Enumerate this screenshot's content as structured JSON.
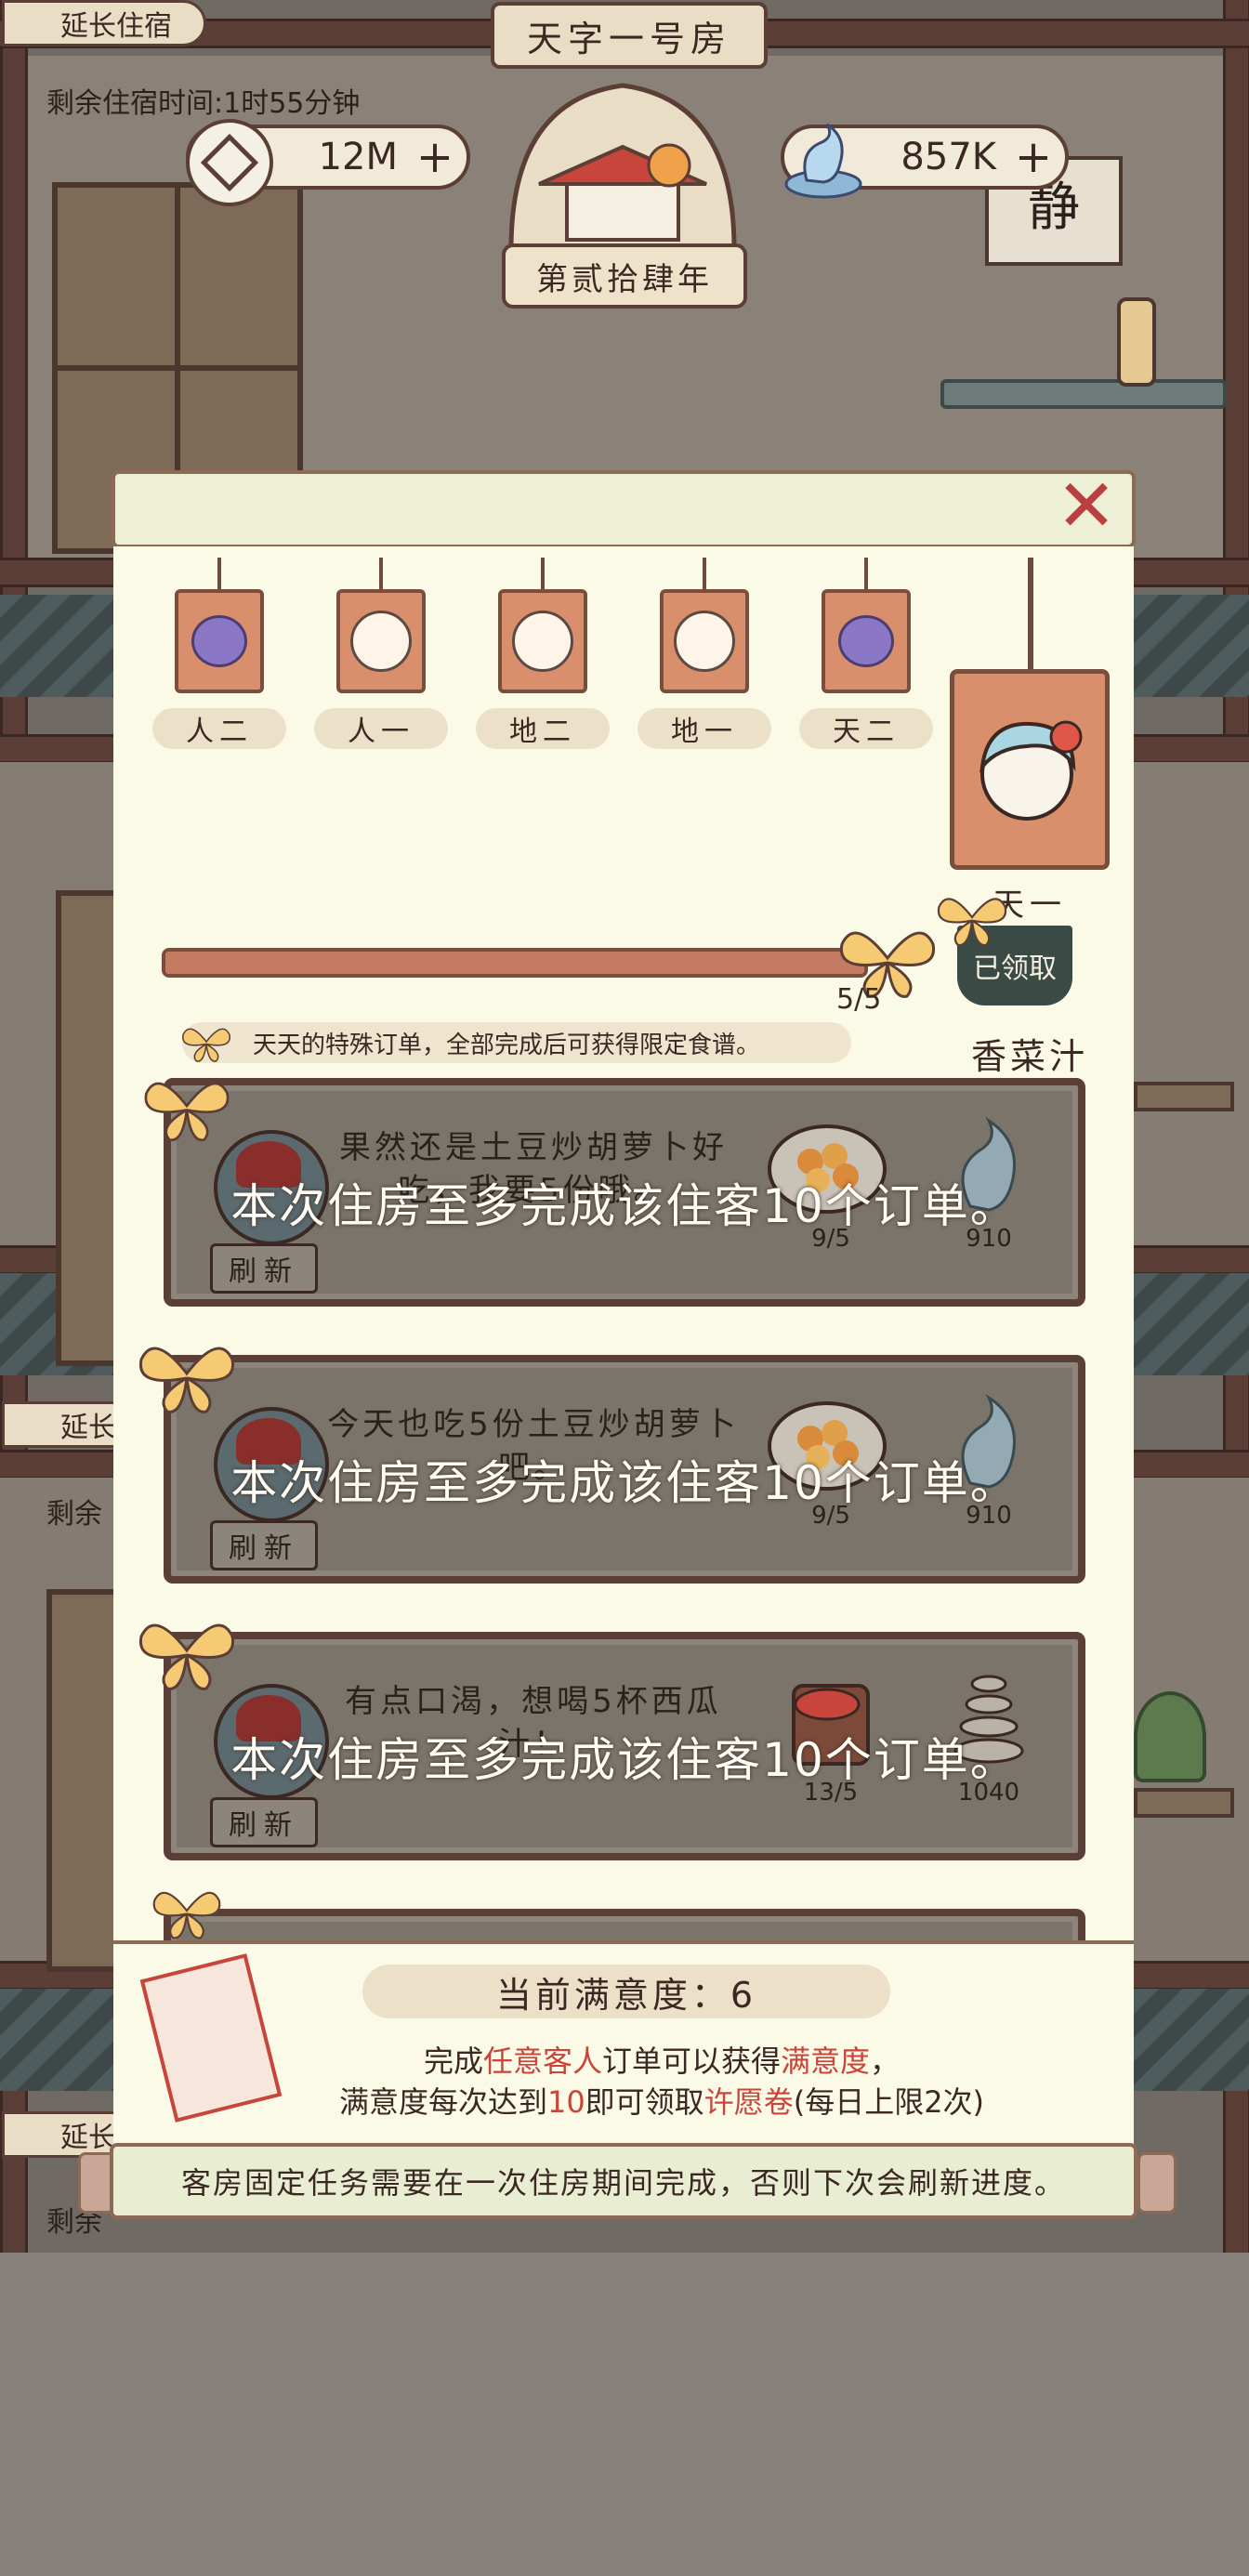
{
  "room": {
    "title": "天字一号房",
    "extend_label": "延长住宿",
    "remaining_time": "剩余住宿时间:1时55分钟",
    "year_label": "第贰拾肆年"
  },
  "resources": {
    "coins": "12M",
    "spirit": "857K"
  },
  "background_texts": {
    "extend_label_2": "延长",
    "extend_label_3": "延长",
    "remain_2": "剩余",
    "remain_3": "剩余"
  },
  "guests": [
    {
      "label": "人二",
      "icon": "fruit-icon"
    },
    {
      "label": "人一",
      "icon": "guest-face-icon"
    },
    {
      "label": "地二",
      "icon": "guest-face-icon"
    },
    {
      "label": "地一",
      "icon": "guest-face-icon"
    },
    {
      "label": "天二",
      "icon": "fruit-icon"
    }
  ],
  "selected_guest": {
    "label": "天一",
    "progress_text": "5/5",
    "progress_fraction": 1.0,
    "claimed_label": "已领取",
    "reward_name": "香菜汁"
  },
  "special_hint": "天天的特殊订单，全部完成后可获得限定食谱。",
  "orders": [
    {
      "message": "果然还是土豆炒胡萝卜好吃，我要5份哦。",
      "item_count": "9/5",
      "reward_count": "910",
      "refresh": "刷新",
      "overlay": "本次住房至多完成该住客10个订单。"
    },
    {
      "message": "今天也吃5份土豆炒胡萝卜吧。",
      "item_count": "9/5",
      "reward_count": "910",
      "refresh": "刷新",
      "overlay": "本次住房至多完成该住客10个订单。"
    },
    {
      "message": "有点口渴，想喝5杯西瓜汁！",
      "item_count": "13/5",
      "reward_count": "1040",
      "refresh": "刷新",
      "overlay": "本次住房至多完成该住客10个订单。"
    }
  ],
  "satisfaction": {
    "title": "当前满意度：6",
    "line1_a": "完成",
    "line1_hl1": "任意客人",
    "line1_b": "订单可以获得",
    "line1_hl2": "满意度",
    "line1_c": "，",
    "line2_a": "满意度每次达到",
    "line2_hl1": "10",
    "line2_b": "即可领取",
    "line2_hl2": "许愿卷",
    "line2_c": "(每日上限2次)"
  },
  "footer_note": "客房固定任务需要在一次住房期间完成，否则下次会刷新进度。",
  "colors": {
    "panel": "#fbfae6",
    "frame": "#5b3f36",
    "highlight": "#c8453b",
    "tag": "#d98f6c"
  }
}
